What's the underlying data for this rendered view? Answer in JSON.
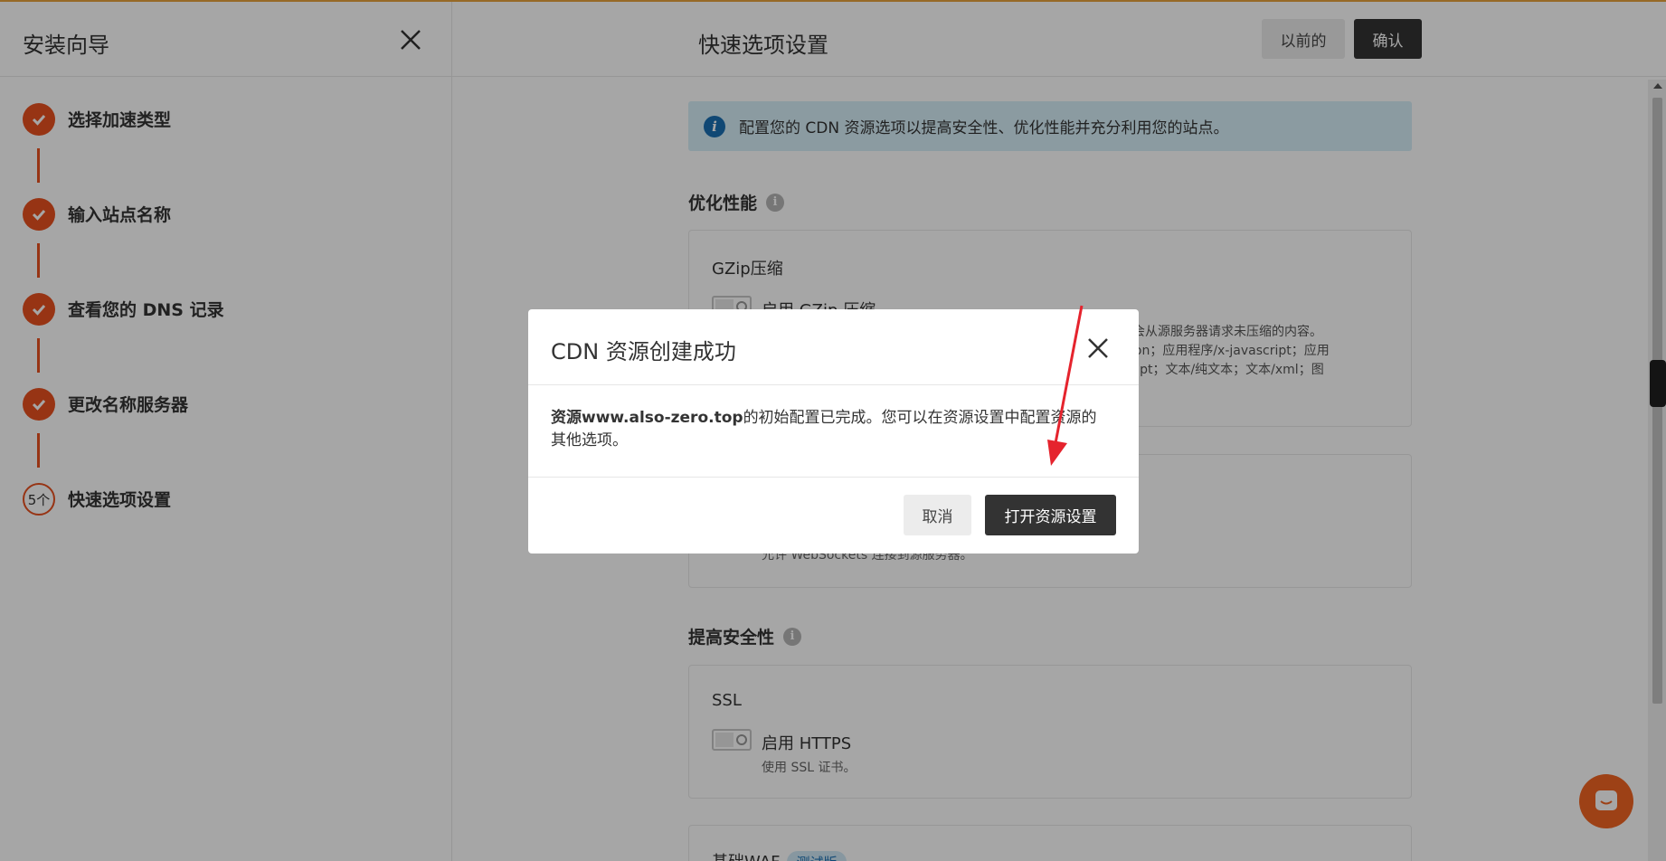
{
  "sidebar": {
    "title": "安装向导",
    "steps": [
      {
        "label": "选择加速类型",
        "status": "done"
      },
      {
        "label": "输入站点名称",
        "status": "done"
      },
      {
        "label": "查看您的 DNS 记录",
        "status": "done"
      },
      {
        "label": "更改名称服务器",
        "status": "done"
      },
      {
        "label": "快速选项设置",
        "status": "current",
        "number": "5个"
      }
    ]
  },
  "header": {
    "title": "快速选项设置",
    "prev_label": "以前的",
    "confirm_label": "确认"
  },
  "info": {
    "text": "配置您的 CDN 资源选项以提高安全性、优化性能并充分利用您的站点。"
  },
  "sections": {
    "optimize": "优化性能",
    "security": "提高安全性"
  },
  "gzip": {
    "title": "GZip压缩",
    "toggle_label": "启用 GZip 压缩",
    "desc_line1": "然后只会从源服务器请求未压缩的内容。",
    "desc_line2": "程序/json；应用程序/x-javascript；应用",
    "desc_line3": "avascript；文本/纯文本；文本/xml；图"
  },
  "websocket": {
    "desc": "允许 WebSockets 连接到源服务器。"
  },
  "ssl": {
    "title": "SSL",
    "toggle_label": "启用 HTTPS",
    "desc": "使用 SSL 证书。"
  },
  "waf": {
    "title": "基础WAF",
    "badge": "测试版"
  },
  "modal": {
    "title": "CDN 资源创建成功",
    "body_bold": "资源www.also-zero.top",
    "body_rest": "的初始配置已完成。您可以在资源设置中配置资源的其他选项。",
    "cancel_label": "取消",
    "open_label": "打开资源设置"
  },
  "colors": {
    "accent": "#e8501f",
    "dark_button": "#333333",
    "info_bg": "#d6eef8",
    "annotation_arrow": "#e5232d",
    "chat": "#f26522"
  }
}
